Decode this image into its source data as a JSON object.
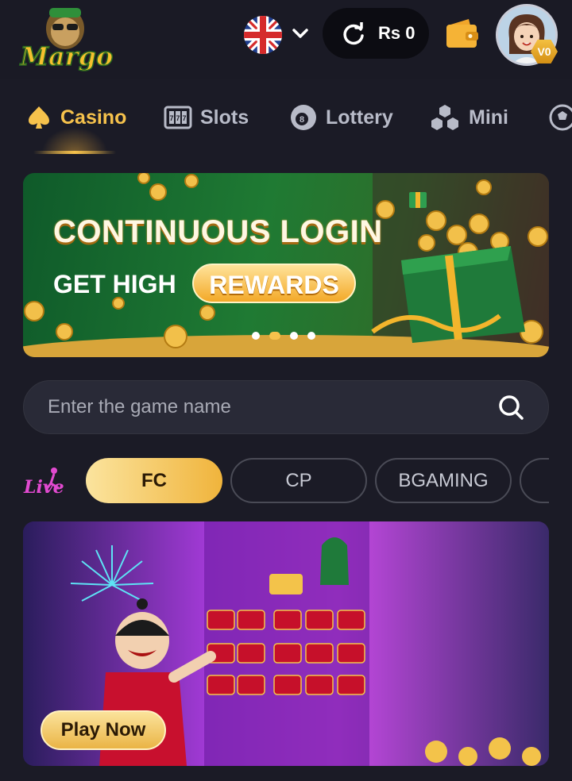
{
  "header": {
    "logo_text": "Margo",
    "language_flag": "uk-flag-icon",
    "balance": "Rs 0",
    "vip_level": "V0"
  },
  "categories": [
    {
      "label": "Casino",
      "icon": "spade-icon",
      "active": true
    },
    {
      "label": "Slots",
      "icon": "slot-machine-icon",
      "active": false
    },
    {
      "label": "Lottery",
      "icon": "eight-ball-icon",
      "active": false
    },
    {
      "label": "Mini",
      "icon": "cubes-icon",
      "active": false
    }
  ],
  "banner": {
    "title": "CONTINUOUS LOGIN",
    "subtitle": "GET HIGH",
    "highlight": "REWARDS"
  },
  "search": {
    "placeholder": "Enter the game name"
  },
  "providers": {
    "logo_text": "Live",
    "items": [
      "FC",
      "CP",
      "BGAMING"
    ],
    "active_index": 0
  },
  "game_card": {
    "play_label": "Play Now"
  },
  "colors": {
    "background": "#1b1b26",
    "accent": "#f6c24c",
    "tab_inactive": "#b8bbc8"
  }
}
